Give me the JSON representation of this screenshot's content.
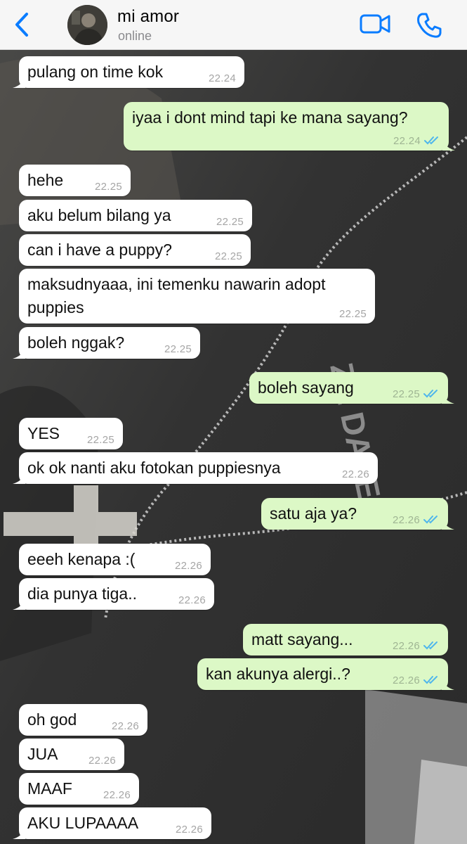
{
  "header": {
    "contact_name": "mi amor",
    "status": "online",
    "icons": [
      "chevron-left-icon",
      "video-camera-icon",
      "phone-icon"
    ],
    "accent_color": "#0a7cff"
  },
  "colors": {
    "incoming_bubble": "#ffffff",
    "outgoing_bubble": "#dcf8c6",
    "read_ticks": "#4fb6ec"
  },
  "messages": [
    {
      "dir": "in",
      "text": "pulang on time kok",
      "time": "22.24"
    },
    {
      "dir": "out",
      "text": "iyaa i dont mind tapi ke mana sayang?",
      "time": "22.24",
      "read": true
    },
    {
      "dir": "in",
      "text": "hehe",
      "time": "22.25"
    },
    {
      "dir": "in",
      "text": "aku belum bilang ya",
      "time": "22.25"
    },
    {
      "dir": "in",
      "text": "can i have a puppy?",
      "time": "22.25"
    },
    {
      "dir": "in",
      "text": "maksudnyaaa, ini temenku nawarin adopt\npuppies",
      "time": "22.25"
    },
    {
      "dir": "in",
      "text": "boleh nggak?",
      "time": "22.25"
    },
    {
      "dir": "out",
      "text": "boleh sayang",
      "time": "22.25",
      "read": true
    },
    {
      "dir": "in",
      "text": "YES",
      "time": "22.25"
    },
    {
      "dir": "in",
      "text": "ok ok nanti aku fotokan puppiesnya",
      "time": "22.26"
    },
    {
      "dir": "out",
      "text": "satu aja ya?",
      "time": "22.26",
      "read": true
    },
    {
      "dir": "in",
      "text": "eeeh kenapa :(",
      "time": "22.26"
    },
    {
      "dir": "in",
      "text": "dia punya tiga..",
      "time": "22.26"
    },
    {
      "dir": "out",
      "text": "matt sayang...",
      "time": "22.26",
      "read": true
    },
    {
      "dir": "out",
      "text": "kan akunya alergi..?",
      "time": "22.26",
      "read": true
    },
    {
      "dir": "in",
      "text": "oh god",
      "time": "22.26"
    },
    {
      "dir": "in",
      "text": "JUA",
      "time": "22.26"
    },
    {
      "dir": "in",
      "text": "MAAF",
      "time": "22.26"
    },
    {
      "dir": "in",
      "text": "AKU LUPAAAA",
      "time": "22.26"
    }
  ]
}
